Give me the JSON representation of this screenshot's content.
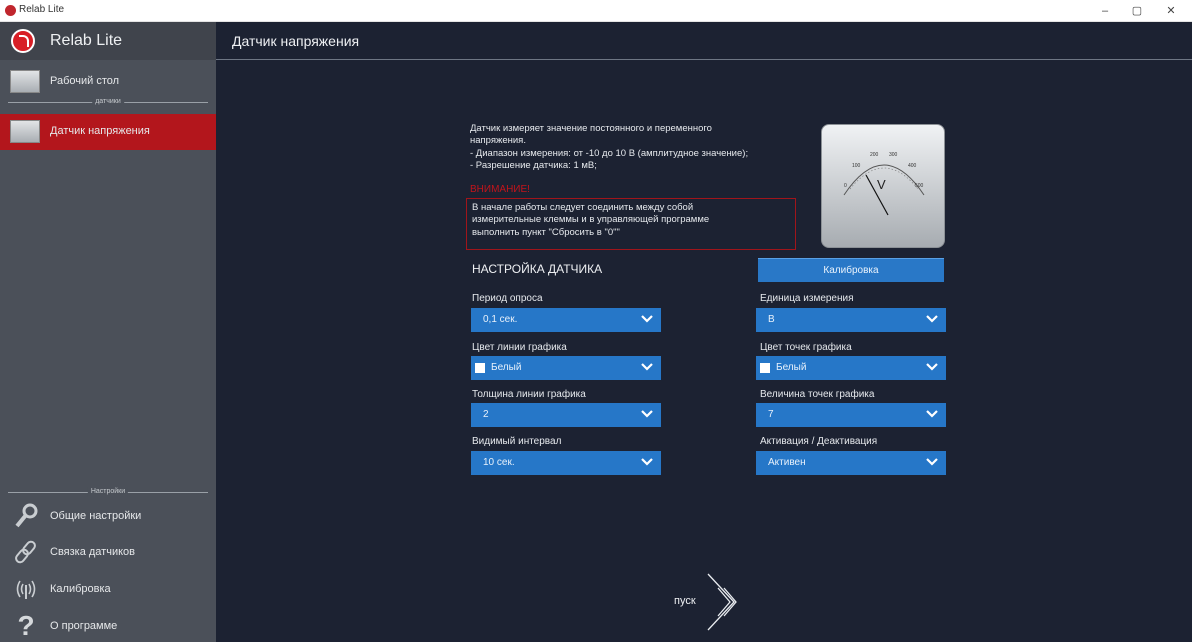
{
  "window": {
    "title": "Relab Lite",
    "controls": [
      "–",
      "▢",
      "✕"
    ]
  },
  "sidebar": {
    "brand": "Relab Lite",
    "items_top": [
      {
        "label": "Рабочий стол",
        "icon": "monitor-icon"
      }
    ],
    "separator_sensors": "датчики",
    "sensor_items": [
      {
        "label": "Датчик напряжения",
        "icon": "voltmeter-icon",
        "active": true
      }
    ],
    "separator_settings": "Настройки",
    "settings_items": [
      {
        "label": "Общие настройки",
        "icon": "wrench-icon"
      },
      {
        "label": "Связка датчиков",
        "icon": "link-icon"
      },
      {
        "label": "Калибровка",
        "icon": "broadcast-icon"
      },
      {
        "label": "О программе",
        "icon": "question-icon"
      }
    ]
  },
  "main": {
    "title": "Датчик напряжения",
    "description": [
      "Датчик измеряет значение постоянного и переменного",
      "напряжения.",
      "- Диапазон измерения: от -10 до 10 В (амплитудное значение);",
      "- Разрешение датчика: 1 мВ;"
    ],
    "warning_title": "ВНИМАНИЕ!",
    "warning_text": [
      "В начале работы следует соединить между собой",
      "измерительные клеммы и в управляющей программе",
      "выполнить пункт \"Сбросить в \"0\"\""
    ],
    "gauge": {
      "unit": "V",
      "scale": [
        "0",
        "100",
        "200",
        "300",
        "400",
        "500"
      ]
    },
    "section_title": "НАСТРОЙКА ДАТЧИКА",
    "calibration_button": "Калибровка",
    "settings": {
      "poll_period": {
        "label": "Период опроса",
        "value": "0,1 сек."
      },
      "unit": {
        "label": "Единица измерения",
        "value": "В"
      },
      "line_color": {
        "label": "Цвет линии графика",
        "value": "Белый",
        "swatch": "#ffffff"
      },
      "point_color": {
        "label": "Цвет точек графика",
        "value": "Белый",
        "swatch": "#ffffff"
      },
      "line_width": {
        "label": "Толщина линии графика",
        "value": "2"
      },
      "point_size": {
        "label": "Величина точек графика",
        "value": "7"
      },
      "visible_interval": {
        "label": "Видимый интервал",
        "value": "10 сек."
      },
      "activation": {
        "label": "Активация / Деактивация",
        "value": "Активен"
      }
    },
    "start_button": "пуск"
  },
  "colors": {
    "sidebar_bg": "#4b5059",
    "active_item": "#b3161c",
    "main_bg": "#1c2232",
    "accent_blue": "#2677c8",
    "warning_red": "#c2141b"
  }
}
